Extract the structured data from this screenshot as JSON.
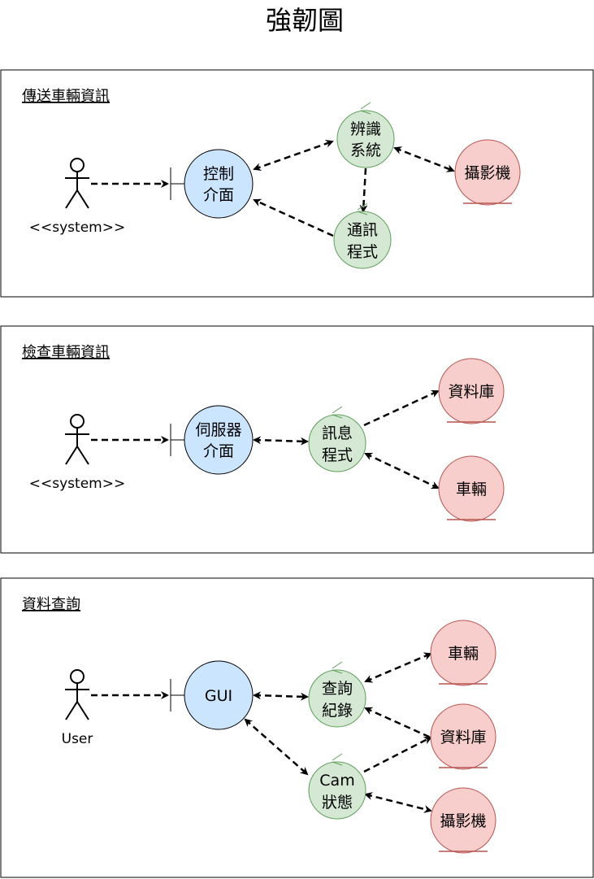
{
  "title": "強韌圖",
  "colors": {
    "boundary_fill": "#cce5ff",
    "control_fill": "#d5e8d4",
    "control_stroke": "#5fa05a",
    "entity_fill": "#f8cecc",
    "entity_stroke": "#b85450"
  },
  "frames": [
    {
      "label": "傳送車輛資訊",
      "actor": {
        "label": "<<system>>"
      },
      "nodes": {
        "control_ui": [
          "控制",
          "介面"
        ],
        "recognition": [
          "辨識",
          "系統"
        ],
        "comm": [
          "通訊",
          "程式"
        ],
        "camera": [
          "攝影機"
        ]
      }
    },
    {
      "label": "檢查車輛資訊",
      "actor": {
        "label": "<<system>>"
      },
      "nodes": {
        "server_ui": [
          "伺服器",
          "介面"
        ],
        "message": [
          "訊息",
          "程式"
        ],
        "database": [
          "資料庫"
        ],
        "vehicle": [
          "車輛"
        ]
      }
    },
    {
      "label": "資料查詢",
      "actor": {
        "label": "User"
      },
      "nodes": {
        "gui": [
          "GUI"
        ],
        "query": [
          "查詢",
          "紀錄"
        ],
        "cam_status": [
          "Cam",
          "狀態"
        ],
        "vehicle": [
          "車輛"
        ],
        "database": [
          "資料庫"
        ],
        "camera": [
          "攝影機"
        ]
      }
    }
  ]
}
